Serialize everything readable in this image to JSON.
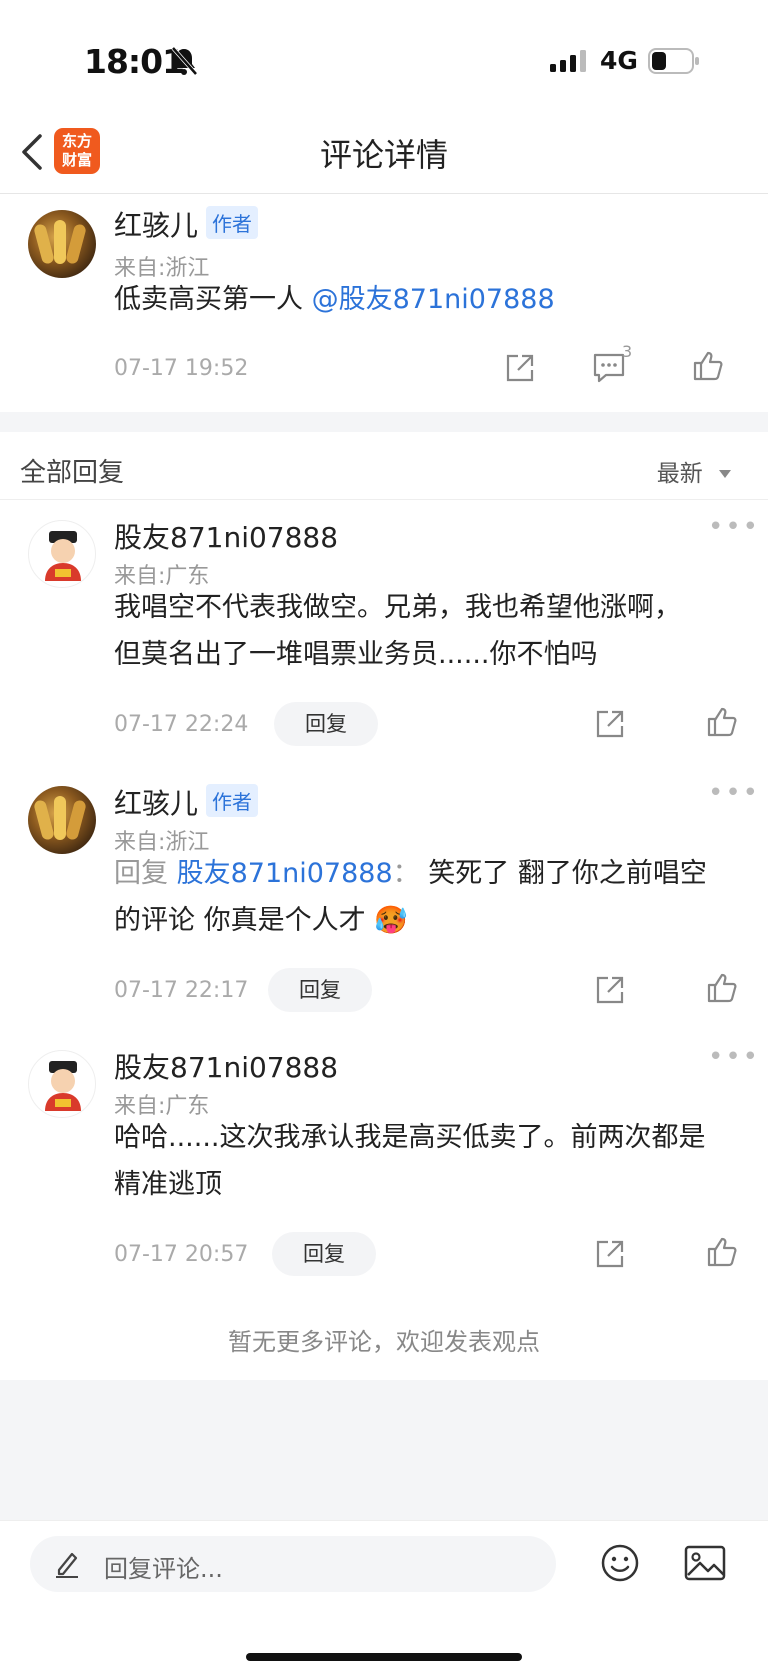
{
  "status_bar": {
    "time": "18:01",
    "network": "4G"
  },
  "nav": {
    "title": "评论详情",
    "logo_line1": "东方",
    "logo_line2": "财富"
  },
  "main_comment": {
    "name": "红骇儿",
    "tag": "作者",
    "from": "来自:浙江",
    "text": "低卖高买第一人",
    "mention": "@股友871ni07888",
    "date": "07-17 19:52",
    "comment_count": "3"
  },
  "reply_section": {
    "title": "全部回复",
    "sort_label": "最新"
  },
  "replies": [
    {
      "name": "股友871ni07888",
      "from": "来自:广东",
      "line1": "我唱空不代表我做空。兄弟，我也希望他涨啊，",
      "line2": "但莫名出了一堆唱票业务员......你不怕吗",
      "date": "07-17 22:24",
      "reply_label": "回复"
    },
    {
      "name": "红骇儿",
      "tag": "作者",
      "from": "来自:浙江",
      "reply_prefix": "回复",
      "reply_target": "股友871ni07888",
      "reply_colon": "：",
      "line1_rest": "笑死了 翻了你之前唱空",
      "line2": "的评论 你真是个人才",
      "emoji": "🥵",
      "date": "07-17 22:17",
      "reply_label": "回复"
    },
    {
      "name": "股友871ni07888",
      "from": "来自:广东",
      "line1": "哈哈......这次我承认我是高买低卖了。前两次都是",
      "line2": "精准逃顶",
      "date": "07-17 20:57",
      "reply_label": "回复"
    }
  ],
  "no_more_text": "暂无更多评论，欢迎发表观点",
  "bottom_bar": {
    "placeholder": "回复评论..."
  },
  "colors": {
    "accent": "#2c73d9",
    "logo": "#f05a1e"
  },
  "icons": [
    "bell-off-icon",
    "signal-icon",
    "battery-icon",
    "back-icon",
    "share-icon",
    "comment-icon",
    "like-icon",
    "more-icon",
    "pencil-icon",
    "emoji-icon",
    "image-icon",
    "sort-caret-icon"
  ]
}
